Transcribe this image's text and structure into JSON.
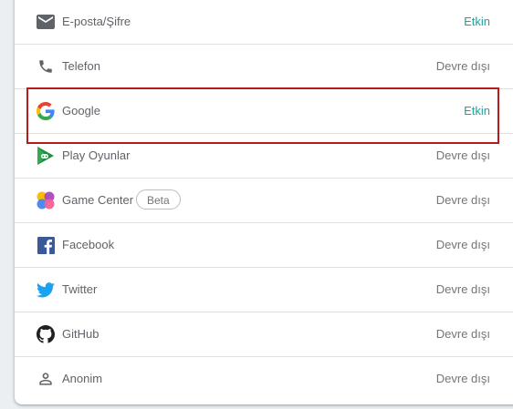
{
  "providers": [
    {
      "label": "E-posta/Şifre",
      "status": "Etkin",
      "icon": "email-icon"
    },
    {
      "label": "Telefon",
      "status": "Devre dışı",
      "icon": "phone-icon"
    },
    {
      "label": "Google",
      "status": "Etkin",
      "icon": "google-icon"
    },
    {
      "label": "Play Oyunlar",
      "status": "Devre dışı",
      "icon": "play-games-icon"
    },
    {
      "label": "Game Center",
      "status": "Devre dışı",
      "icon": "game-center-icon",
      "badge": "Beta"
    },
    {
      "label": "Facebook",
      "status": "Devre dışı",
      "icon": "facebook-icon"
    },
    {
      "label": "Twitter",
      "status": "Devre dışı",
      "icon": "twitter-icon"
    },
    {
      "label": "GitHub",
      "status": "Devre dışı",
      "icon": "github-icon"
    },
    {
      "label": "Anonim",
      "status": "Devre dışı",
      "icon": "anonymous-icon"
    }
  ],
  "colors": {
    "enabled": "#13a89e",
    "disabled": "#757575",
    "highlight_border": "#b71c1c"
  }
}
